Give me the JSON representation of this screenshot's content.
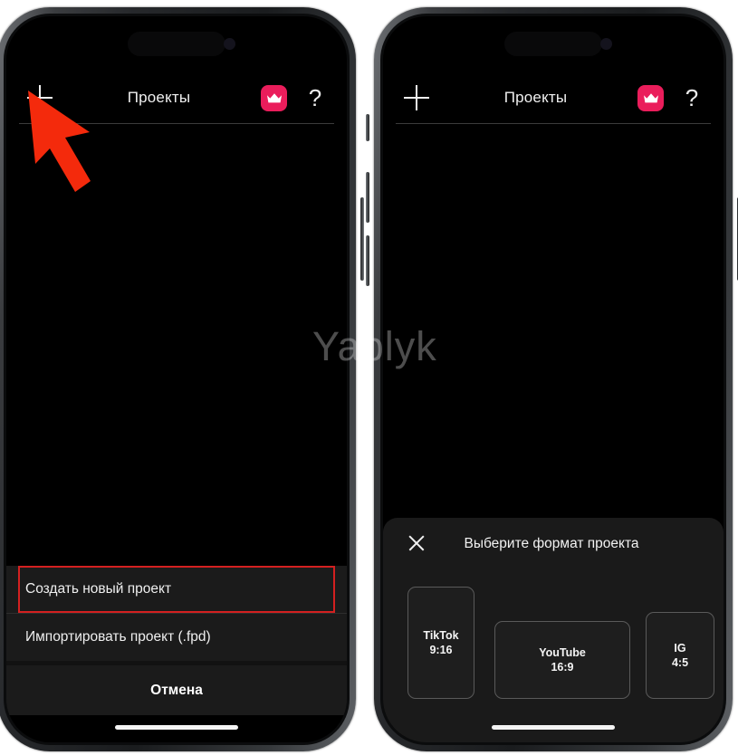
{
  "watermark": "Yablyk",
  "topbar": {
    "add_icon": "plus-icon",
    "title": "Проекты",
    "premium_icon": "crown-icon",
    "premium_color": "#ea1d5b",
    "help_label": "?"
  },
  "left_phone": {
    "action_sheet": {
      "items": [
        {
          "label": "Создать новый проект",
          "highlighted": true
        },
        {
          "label": "Импортировать проект (.fpd)",
          "highlighted": false
        }
      ],
      "cancel_label": "Отмена"
    },
    "annotation": {
      "arrow_color": "#f42a0c",
      "highlight_color": "#d32020",
      "points_to": "plus-icon"
    }
  },
  "right_phone": {
    "format_sheet": {
      "close_icon": "close-icon",
      "title": "Выберите формат проекта",
      "cards": [
        {
          "name": "TikTok",
          "ratio": "9:16"
        },
        {
          "name": "YouTube",
          "ratio": "16:9"
        },
        {
          "name": "IG",
          "ratio": "4:5"
        },
        {
          "name": "",
          "ratio": ""
        }
      ]
    }
  }
}
